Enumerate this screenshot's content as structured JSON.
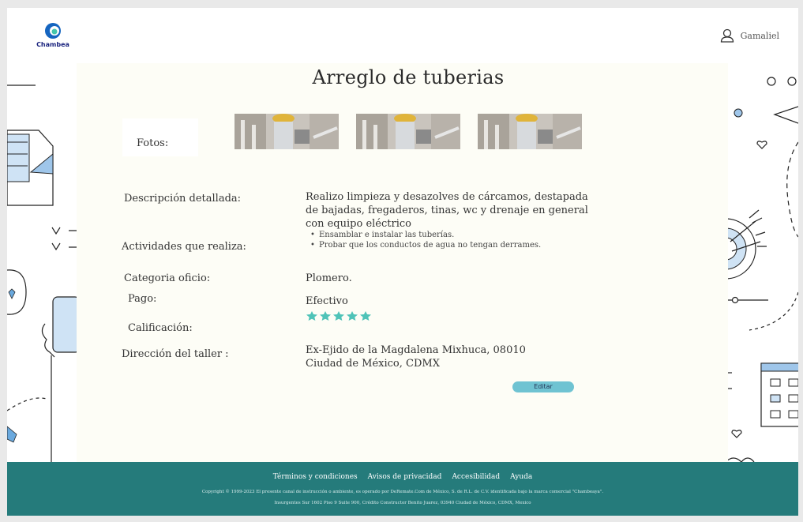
{
  "header": {
    "logo_text": "Chambea",
    "user_name": "Gamaliel",
    "brand_colors": {
      "blue": "#1565c0",
      "green": "#43c6ac"
    }
  },
  "service": {
    "title": "Arreglo de tuberias",
    "photos_label": "Fotos:",
    "photos_count": 3,
    "description_label": "Descripción detallada:",
    "description": "Realizo limpieza y desazolves de cárcamos, destapada de bajadas, fregaderos, tinas, wc y drenaje en general con equipo eléctrico",
    "activities_label": "Actividades que realiza:",
    "activities": [
      "Ensamblar e instalar las tuberías.",
      "Probar que los conductos de agua no tengan derrames."
    ],
    "category_label": "Categoria oficio:",
    "category": "Plomero.",
    "payment_label": "Pago:",
    "payment": "Efectivo",
    "rating_label": "Calificación:",
    "rating": 5,
    "rating_max": 5,
    "star_color": "#4fc3b8",
    "address_label": "Dirección del taller :",
    "address_line1": "Ex-Ejido de la Magdalena Mixhuca, 08010",
    "address_line2": "Ciudad de México, CDMX",
    "edit_label": "Editar"
  },
  "footer": {
    "links": [
      "Términos y condiciones",
      "Avisos de privacidad",
      "Accesibilidad",
      "Ayuda"
    ],
    "copyright": "Copyright © 1999-2023 El presente canal de instrucción o ambiente, es operado por DeRemate.Com de México, S. de R.L. de C.V. identificada bajo la marca comercial \"Chambeaya\".",
    "address": "Insurgentes Sur 1602 Piso 9 Suite 900, Crédito Constructor Benito Juarez, 03940 Ciudad de México, CDMX, Mexico",
    "background": "#257b7b"
  }
}
